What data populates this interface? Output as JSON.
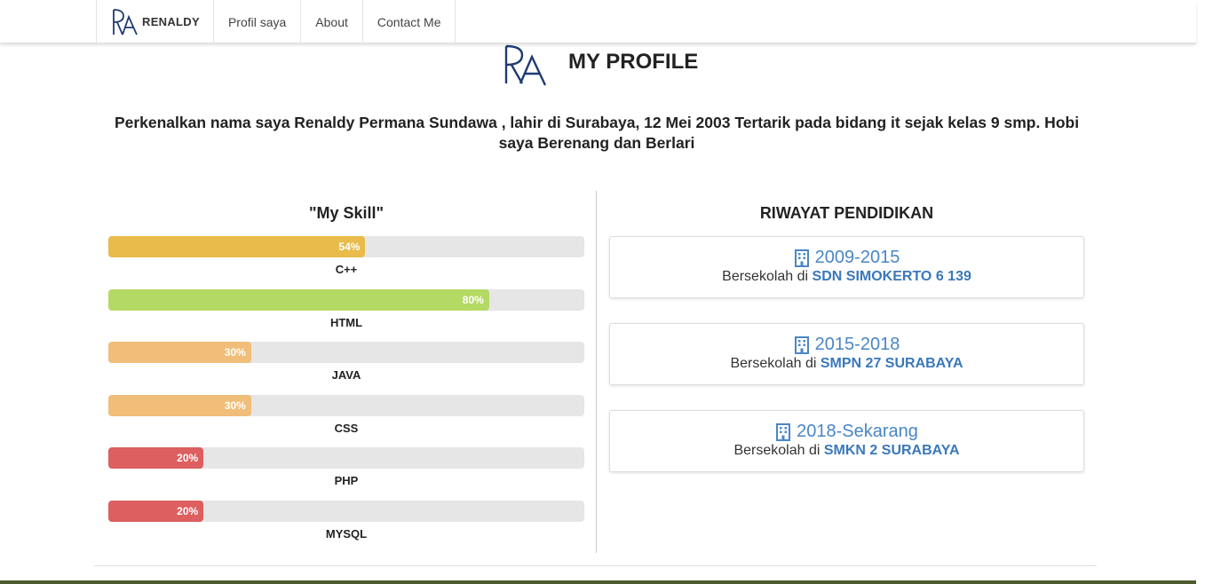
{
  "nav": {
    "brand": "RENALDY",
    "links": [
      "Profil saya",
      "About",
      "Contact Me"
    ]
  },
  "profile": {
    "title": "MY PROFILE",
    "intro": "Perkenalkan nama saya Renaldy Permana Sundawa , lahir di Surabaya, 12 Mei 2003 Tertarik pada bidang it sejak kelas 9 smp. Hobi saya Berenang dan Berlari"
  },
  "skills": {
    "title": "\"My Skill\"",
    "items": [
      {
        "name": "C++",
        "percent_label": "54%",
        "value": 54,
        "color": "#e8bb4a"
      },
      {
        "name": "HTML",
        "percent_label": "80%",
        "value": 80,
        "color": "#b5d965"
      },
      {
        "name": "JAVA",
        "percent_label": "30%",
        "value": 30,
        "color": "#f0be78"
      },
      {
        "name": "CSS",
        "percent_label": "30%",
        "value": 30,
        "color": "#f0be78"
      },
      {
        "name": "PHP",
        "percent_label": "20%",
        "value": 20,
        "color": "#dd5f5f"
      },
      {
        "name": "MYSQL",
        "percent_label": "20%",
        "value": 20,
        "color": "#dd5f5f"
      }
    ]
  },
  "education": {
    "title": "RIWAYAT PENDIDIKAN",
    "prefix": "Bersekolah di",
    "items": [
      {
        "years": "2009-2015",
        "school": "SDN SIMOKERTO 6 139"
      },
      {
        "years": "2015-2018",
        "school": "SMPN 27 SURABAYA"
      },
      {
        "years": "2018-Sekarang",
        "school": "SMKN 2 SURABAYA"
      }
    ]
  },
  "colors": {
    "accent": "#4a86c5",
    "logo": "#1f3b73"
  }
}
